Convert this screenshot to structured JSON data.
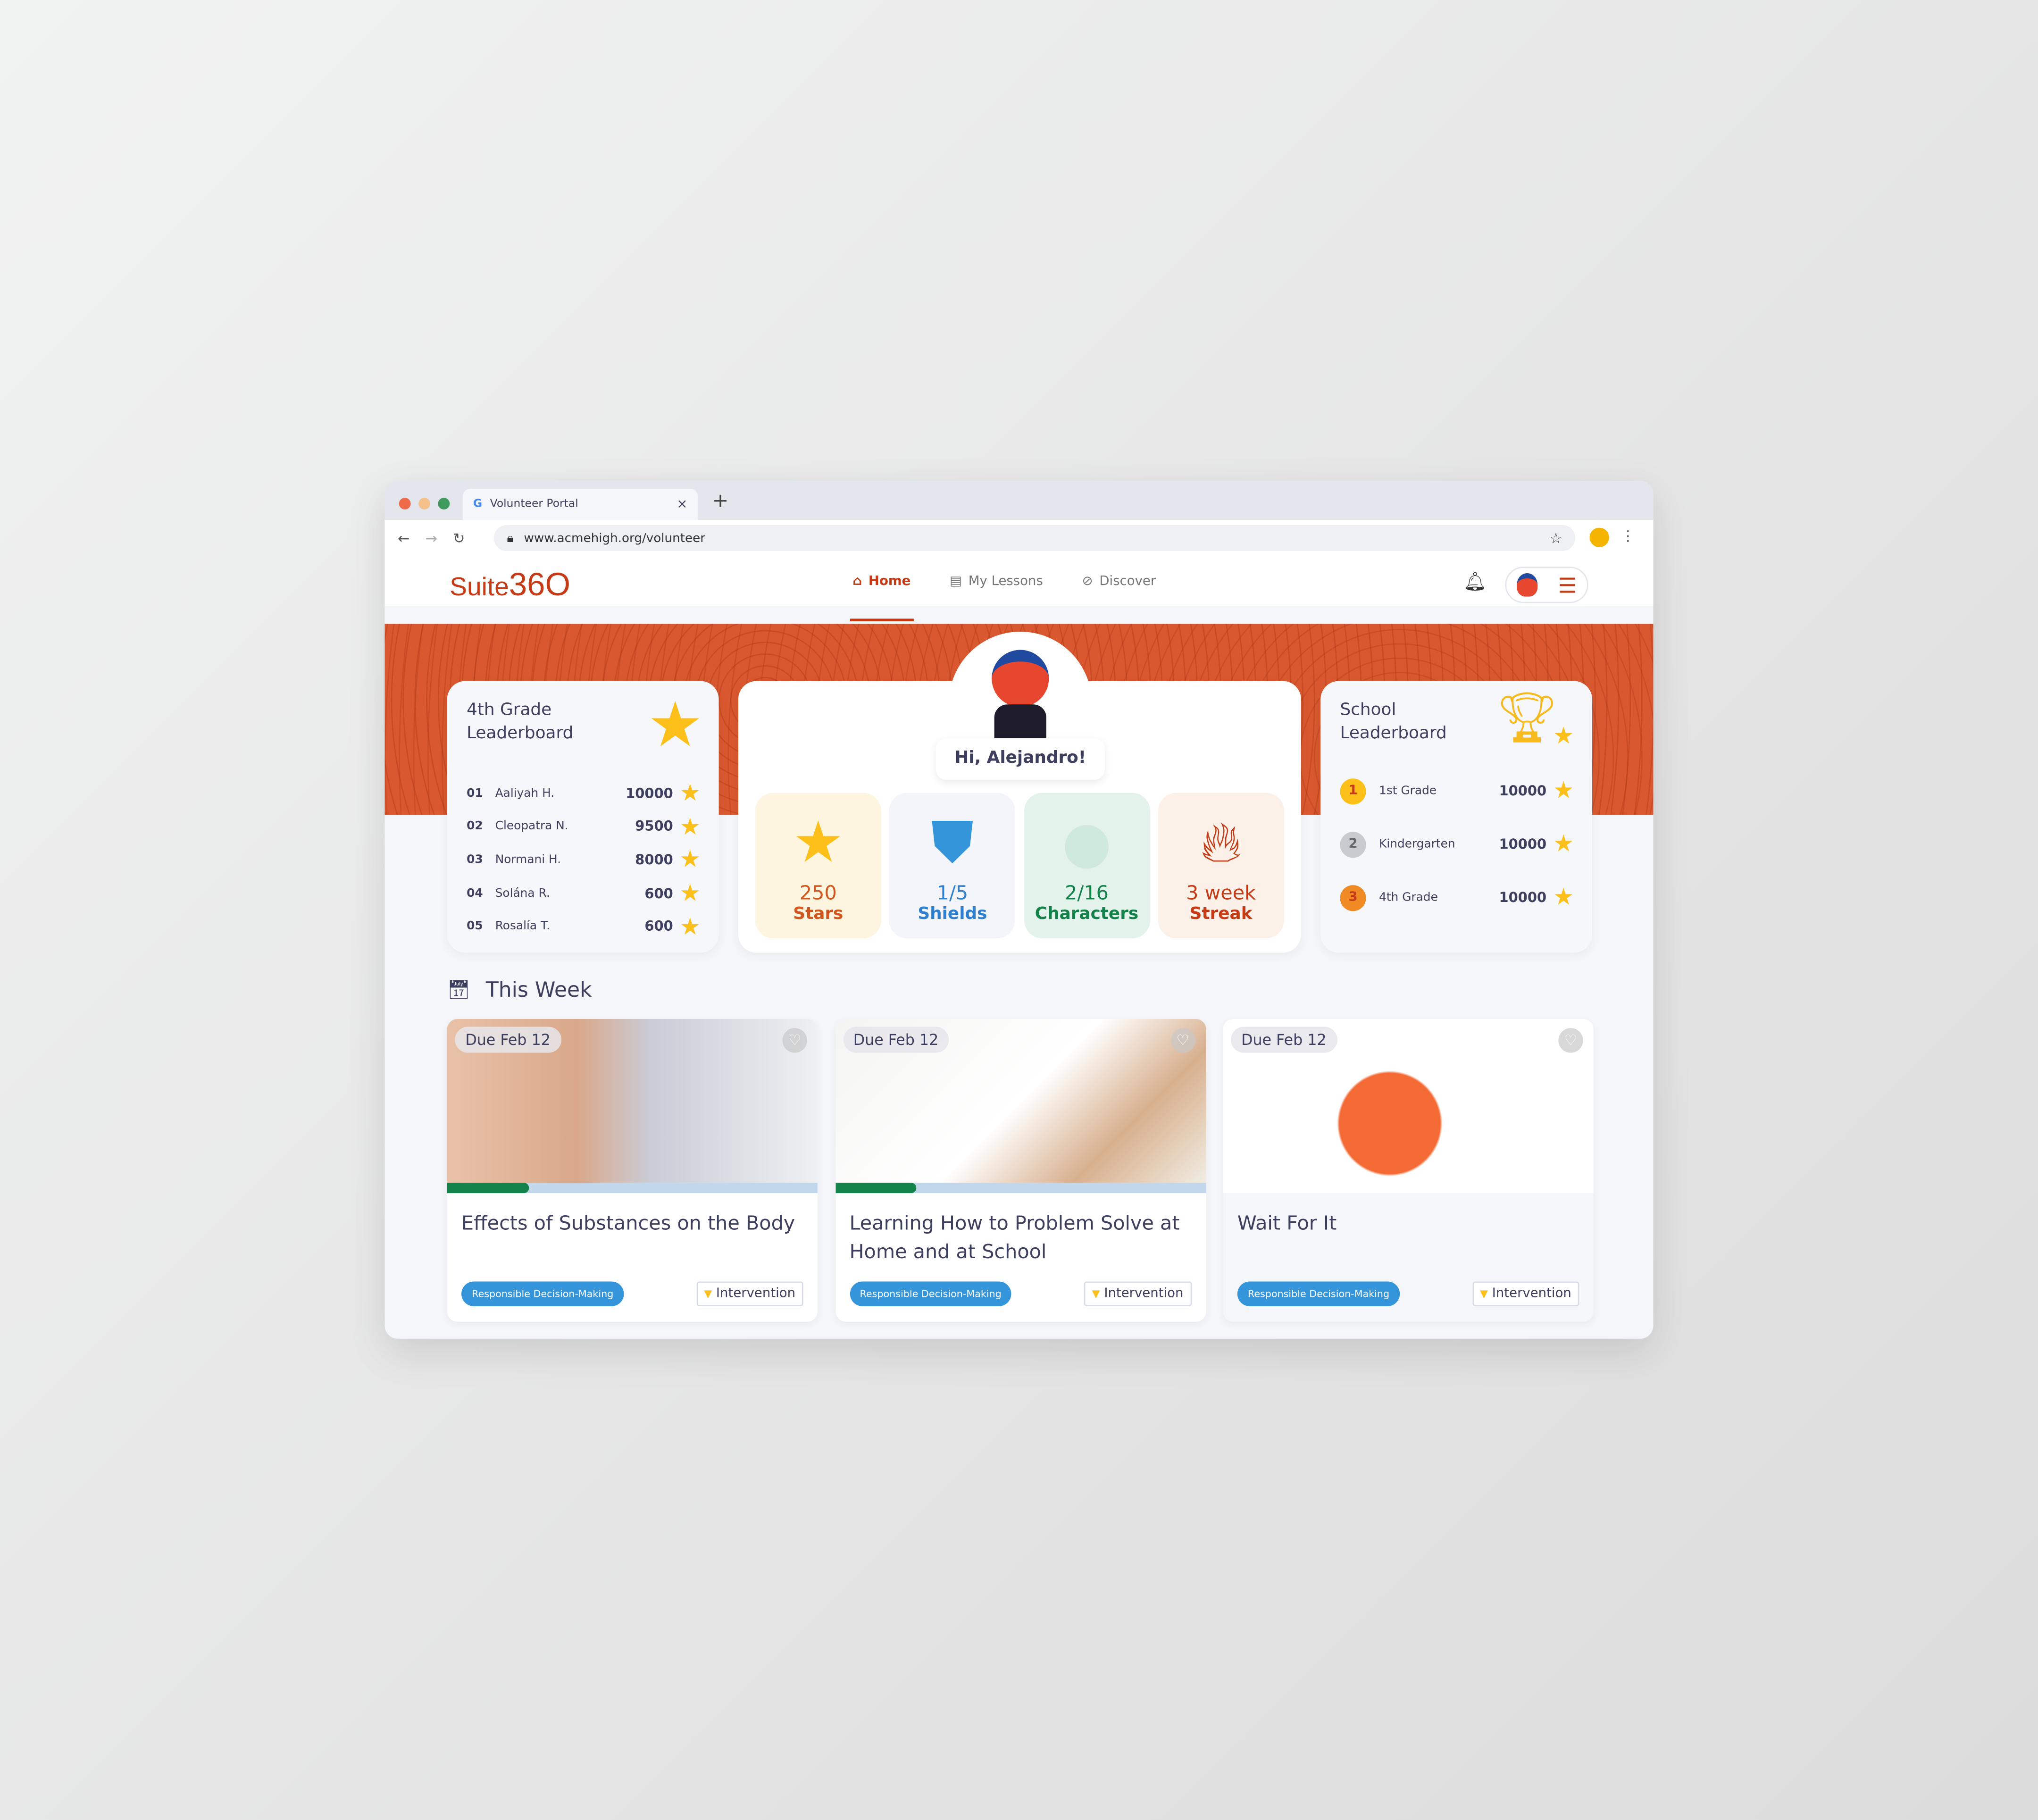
{
  "browser": {
    "tab_title": "Volunteer Portal",
    "url": "www.acmehigh.org/volunteer"
  },
  "app": {
    "logo": "Suite360",
    "nav": [
      {
        "label": "Home",
        "icon": "home-icon",
        "active": true
      },
      {
        "label": "My Lessons",
        "icon": "book-icon"
      },
      {
        "label": "Discover",
        "icon": "compass-icon"
      }
    ]
  },
  "grade_leaderboard": {
    "title_line1": "4th Grade",
    "title_line2": "Leaderboard",
    "rows": [
      {
        "rank": "01",
        "name": "Aaliyah H.",
        "score": "10000"
      },
      {
        "rank": "02",
        "name": "Cleopatra N.",
        "score": "9500"
      },
      {
        "rank": "03",
        "name": "Normani H.",
        "score": "8000"
      },
      {
        "rank": "04",
        "name": "Solána R.",
        "score": "600"
      },
      {
        "rank": "05",
        "name": "Rosalía T.",
        "score": "600"
      }
    ]
  },
  "profile": {
    "greeting": "Hi, Alejandro!",
    "stats": [
      {
        "value": "250",
        "label": "Stars",
        "color": "#d2561f",
        "bg": "#fdf5df"
      },
      {
        "value": "1/5",
        "label": "Shields",
        "color": "#2f7fcf",
        "bg": "#f3f5fa"
      },
      {
        "value": "2/16",
        "label": "Characters",
        "color": "#13824a",
        "bg": "#e4f2ec"
      },
      {
        "value": "3 week",
        "label": "Streak",
        "color": "#c63a16",
        "bg": "#fbf1e8"
      }
    ]
  },
  "school_leaderboard": {
    "title_line1": "School",
    "title_line2": "Leaderboard",
    "rows": [
      {
        "rank": "1",
        "name": "1st Grade",
        "score": "10000",
        "medal": "#fdbf1a"
      },
      {
        "rank": "2",
        "name": "Kindergarten",
        "score": "10000",
        "medal": "#c9cbd0"
      },
      {
        "rank": "3",
        "name": "4th Grade",
        "score": "10000",
        "medal": "#f08a24"
      }
    ]
  },
  "this_week": {
    "title": "This Week",
    "lessons": [
      {
        "due": "Due Feb 12",
        "title": "Effects of Substances on the Body",
        "progress": 0.22,
        "tag": "Responsible Decision-Making",
        "type": "Intervention"
      },
      {
        "due": "Due Feb 12",
        "title": "Learning How to Problem Solve at Home and at School",
        "progress": 0.22,
        "tag": "Responsible Decision-Making",
        "type": "Intervention"
      },
      {
        "due": "Due Feb 12",
        "title": "Wait For It",
        "tag": "Responsible Decision-Making",
        "type": "Intervention"
      }
    ]
  },
  "colors": {
    "brand": "#c63a16",
    "banner": "#d9582f",
    "tag": "#3495db",
    "star": "#fdbf1a"
  }
}
